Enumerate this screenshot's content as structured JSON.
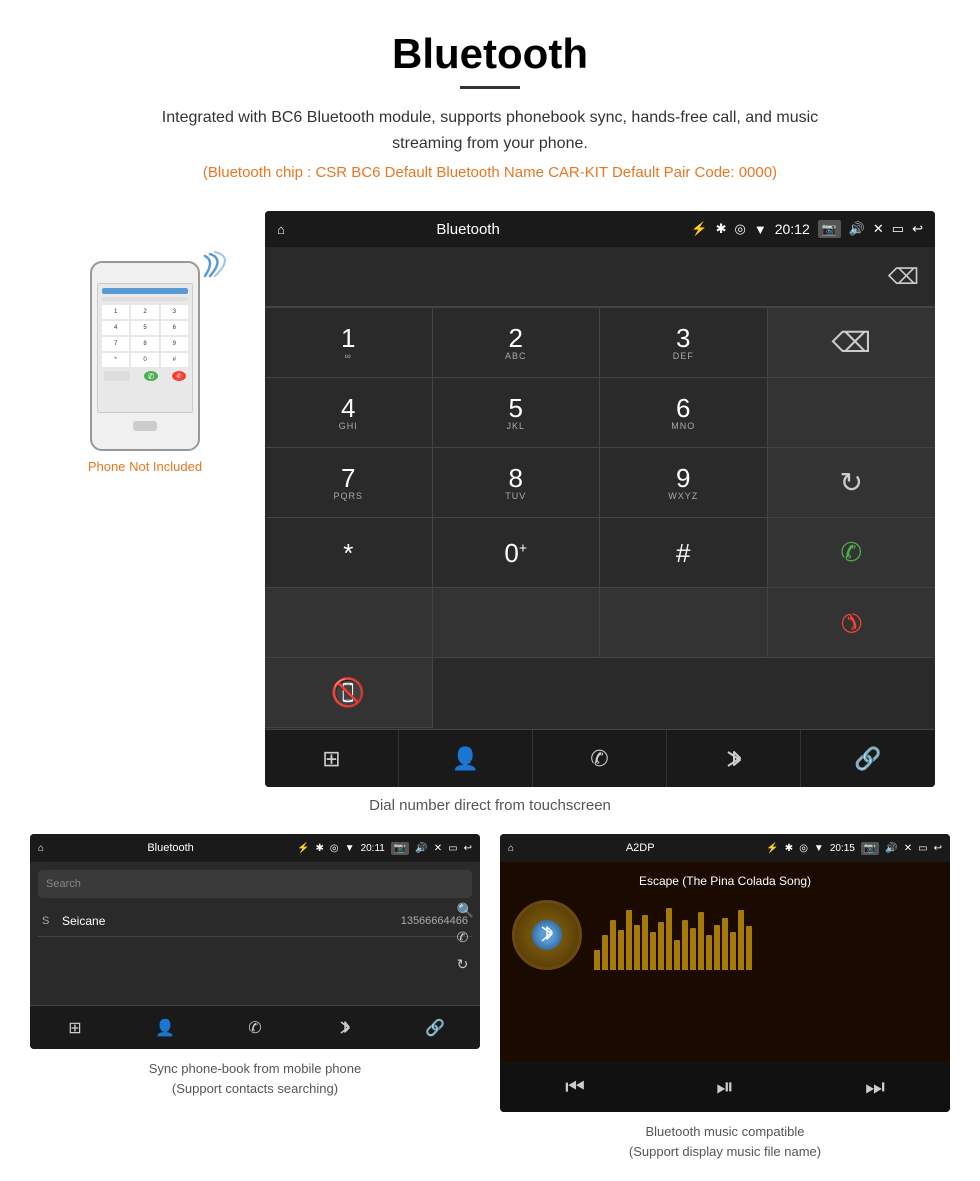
{
  "page": {
    "title": "Bluetooth",
    "description": "Integrated with BC6 Bluetooth module, supports phonebook sync, hands-free call, and music streaming from your phone.",
    "specs": "(Bluetooth chip : CSR BC6    Default Bluetooth Name CAR-KIT    Default Pair Code: 0000)",
    "dial_caption": "Dial number direct from touchscreen",
    "phonebook_caption_line1": "Sync phone-book from mobile phone",
    "phonebook_caption_line2": "(Support contacts searching)",
    "music_caption_line1": "Bluetooth music compatible",
    "music_caption_line2": "(Support display music file name)"
  },
  "dial_screen": {
    "status_bar": {
      "home_icon": "⌂",
      "title": "Bluetooth",
      "usb_icon": "⚡",
      "time": "20:12",
      "icons": [
        "✱",
        "◎",
        "▼"
      ]
    },
    "keys": [
      {
        "num": "1",
        "letters": "∞",
        "col": 1
      },
      {
        "num": "2",
        "letters": "ABC",
        "col": 2
      },
      {
        "num": "3",
        "letters": "DEF",
        "col": 3
      },
      {
        "num": "",
        "letters": "",
        "col": 4,
        "type": "backspace"
      },
      {
        "num": "4",
        "letters": "GHI",
        "col": 1
      },
      {
        "num": "5",
        "letters": "JKL",
        "col": 2
      },
      {
        "num": "6",
        "letters": "MNO",
        "col": 3
      },
      {
        "num": "",
        "letters": "",
        "col": 4,
        "type": "empty"
      },
      {
        "num": "7",
        "letters": "PQRS",
        "col": 1
      },
      {
        "num": "8",
        "letters": "TUV",
        "col": 2
      },
      {
        "num": "9",
        "letters": "WXYZ",
        "col": 3
      },
      {
        "num": "",
        "letters": "",
        "col": 4,
        "type": "reload"
      },
      {
        "num": "*",
        "letters": "",
        "col": 1
      },
      {
        "num": "0",
        "letters": "+",
        "col": 2
      },
      {
        "num": "#",
        "letters": "",
        "col": 3
      },
      {
        "num": "",
        "letters": "",
        "col": 4,
        "type": "call"
      },
      {
        "num": "",
        "letters": "",
        "col": 4,
        "type": "hangup"
      }
    ],
    "bottom_nav_icons": [
      "⊞",
      "👤",
      "✆",
      "✱",
      "🔗"
    ]
  },
  "phonebook_screen": {
    "status_bar": {
      "home_icon": "⌂",
      "title": "Bluetooth",
      "usb_icon": "⚡",
      "time": "20:11"
    },
    "search_placeholder": "Search",
    "contact": {
      "letter": "S",
      "name": "Seicane",
      "number": "13566664466"
    },
    "bottom_nav_icons": [
      "⊞",
      "👤",
      "✆",
      "✱",
      "🔗"
    ]
  },
  "music_screen": {
    "status_bar": {
      "home_icon": "⌂",
      "title": "A2DP",
      "usb_icon": "⚡",
      "time": "20:15"
    },
    "song_title": "Escape (The Pina Colada Song)",
    "bt_symbol": "✱",
    "viz_heights": [
      20,
      35,
      50,
      40,
      60,
      45,
      55,
      38,
      48,
      62,
      30,
      50,
      42,
      58,
      35,
      45,
      52,
      38,
      60,
      44
    ],
    "controls": [
      "⏮",
      "⏯",
      "⏭"
    ]
  },
  "phone_illustration": {
    "not_included": "Phone Not Included"
  }
}
